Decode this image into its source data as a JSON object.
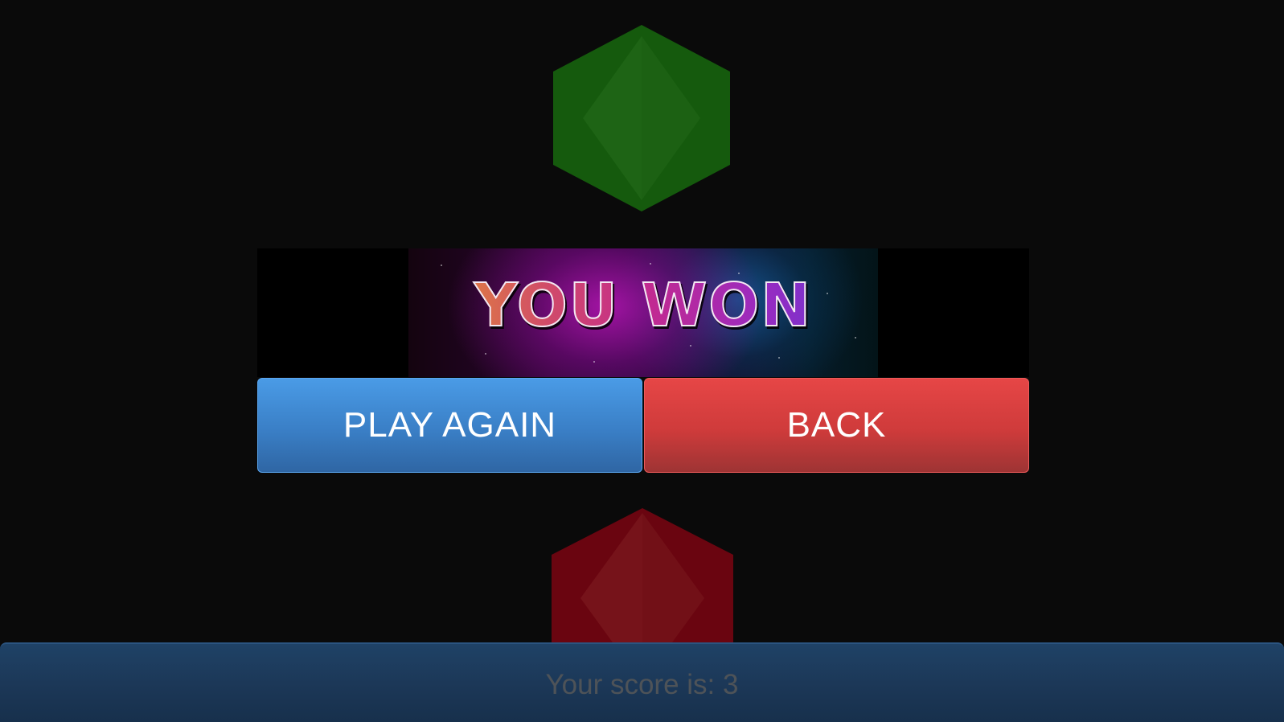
{
  "banner": {
    "title": "YOU WON"
  },
  "buttons": {
    "play_again_label": "PLAY AGAIN",
    "back_label": "BACK"
  },
  "score": {
    "text": "Your score is: 3"
  },
  "colors": {
    "background": "#0a0a0a",
    "hex_top": "#155a0d",
    "hex_bottom": "#6a0510",
    "play_again": "#3a84cc",
    "back": "#d83d3d",
    "score_bar": "#1c3858",
    "score_text": "#4e5358"
  }
}
